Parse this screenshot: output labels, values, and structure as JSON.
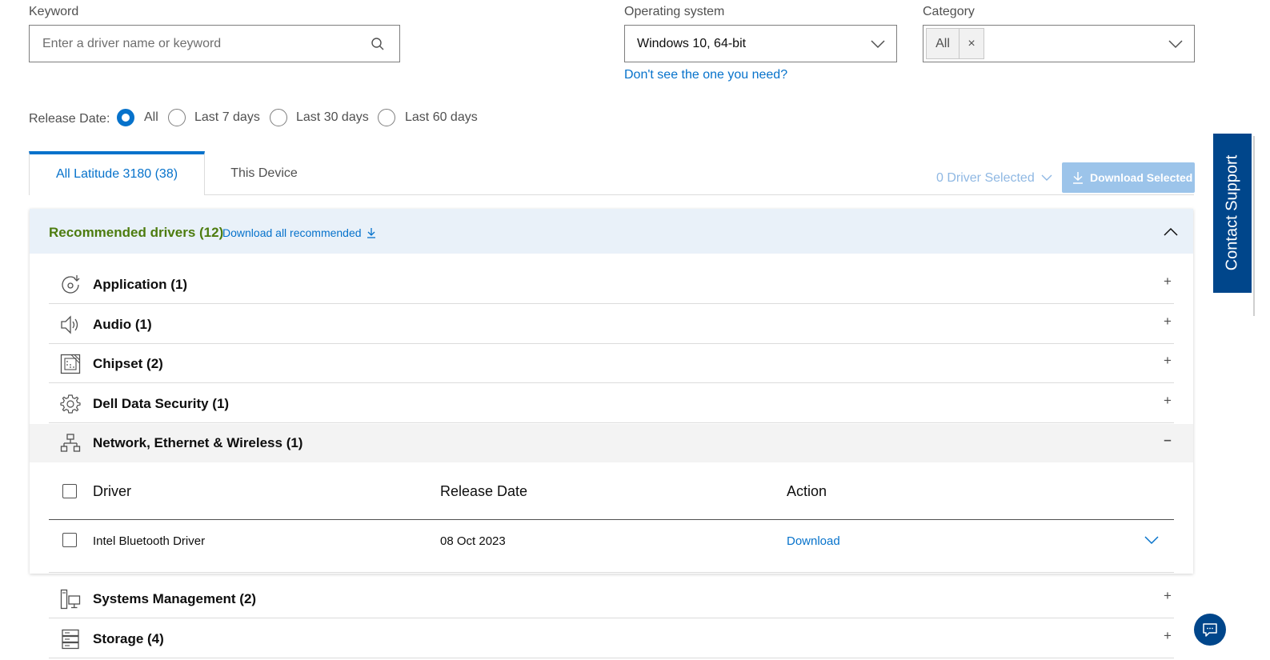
{
  "filters": {
    "keyword": {
      "label": "Keyword",
      "placeholder": "Enter a driver name or keyword"
    },
    "os": {
      "label": "Operating system",
      "value": "Windows 10, 64-bit",
      "help_link": "Don't see the one you need?"
    },
    "category": {
      "label": "Category",
      "chip": "All",
      "chip_remove": "×"
    },
    "release_date": {
      "label": "Release Date:",
      "options": [
        "All",
        "Last 7 days",
        "Last 30 days",
        "Last 60 days"
      ],
      "selected": "All"
    }
  },
  "tabs": [
    {
      "label": "All Latitude 3180 (38)",
      "active": true
    },
    {
      "label": "This Device",
      "active": false
    }
  ],
  "toolbar": {
    "selected_label": "0 Driver Selected",
    "download_selected": "Download Selected"
  },
  "recommended": {
    "title": "Recommended drivers (12)",
    "download_all": "Download all recommended"
  },
  "categories": [
    {
      "name": "Application (1)",
      "icon": "application-icon",
      "toggle": "+"
    },
    {
      "name": "Audio (1)",
      "icon": "speaker-icon",
      "toggle": "+"
    },
    {
      "name": "Chipset (2)",
      "icon": "chipset-icon",
      "toggle": "+"
    },
    {
      "name": "Dell Data Security (1)",
      "icon": "gear-icon",
      "toggle": "+"
    },
    {
      "name": "Network, Ethernet & Wireless (1)",
      "icon": "network-icon",
      "toggle": "–"
    },
    {
      "name": "Systems Management (2)",
      "icon": "systems-management-icon",
      "toggle": "+"
    },
    {
      "name": "Storage (4)",
      "icon": "storage-icon",
      "toggle": "+"
    }
  ],
  "driver_table": {
    "headers": {
      "driver": "Driver",
      "release_date": "Release Date",
      "action": "Action"
    },
    "rows": [
      {
        "driver": "Intel Bluetooth Driver",
        "release_date": "08 Oct 2023",
        "action": "Download"
      }
    ]
  },
  "contact_support": "Contact Support",
  "colors": {
    "accent": "#0672cb",
    "recommended_green": "#4d7c0f",
    "panel_bg": "#e9f1f9",
    "contact_bg": "#00468b"
  }
}
